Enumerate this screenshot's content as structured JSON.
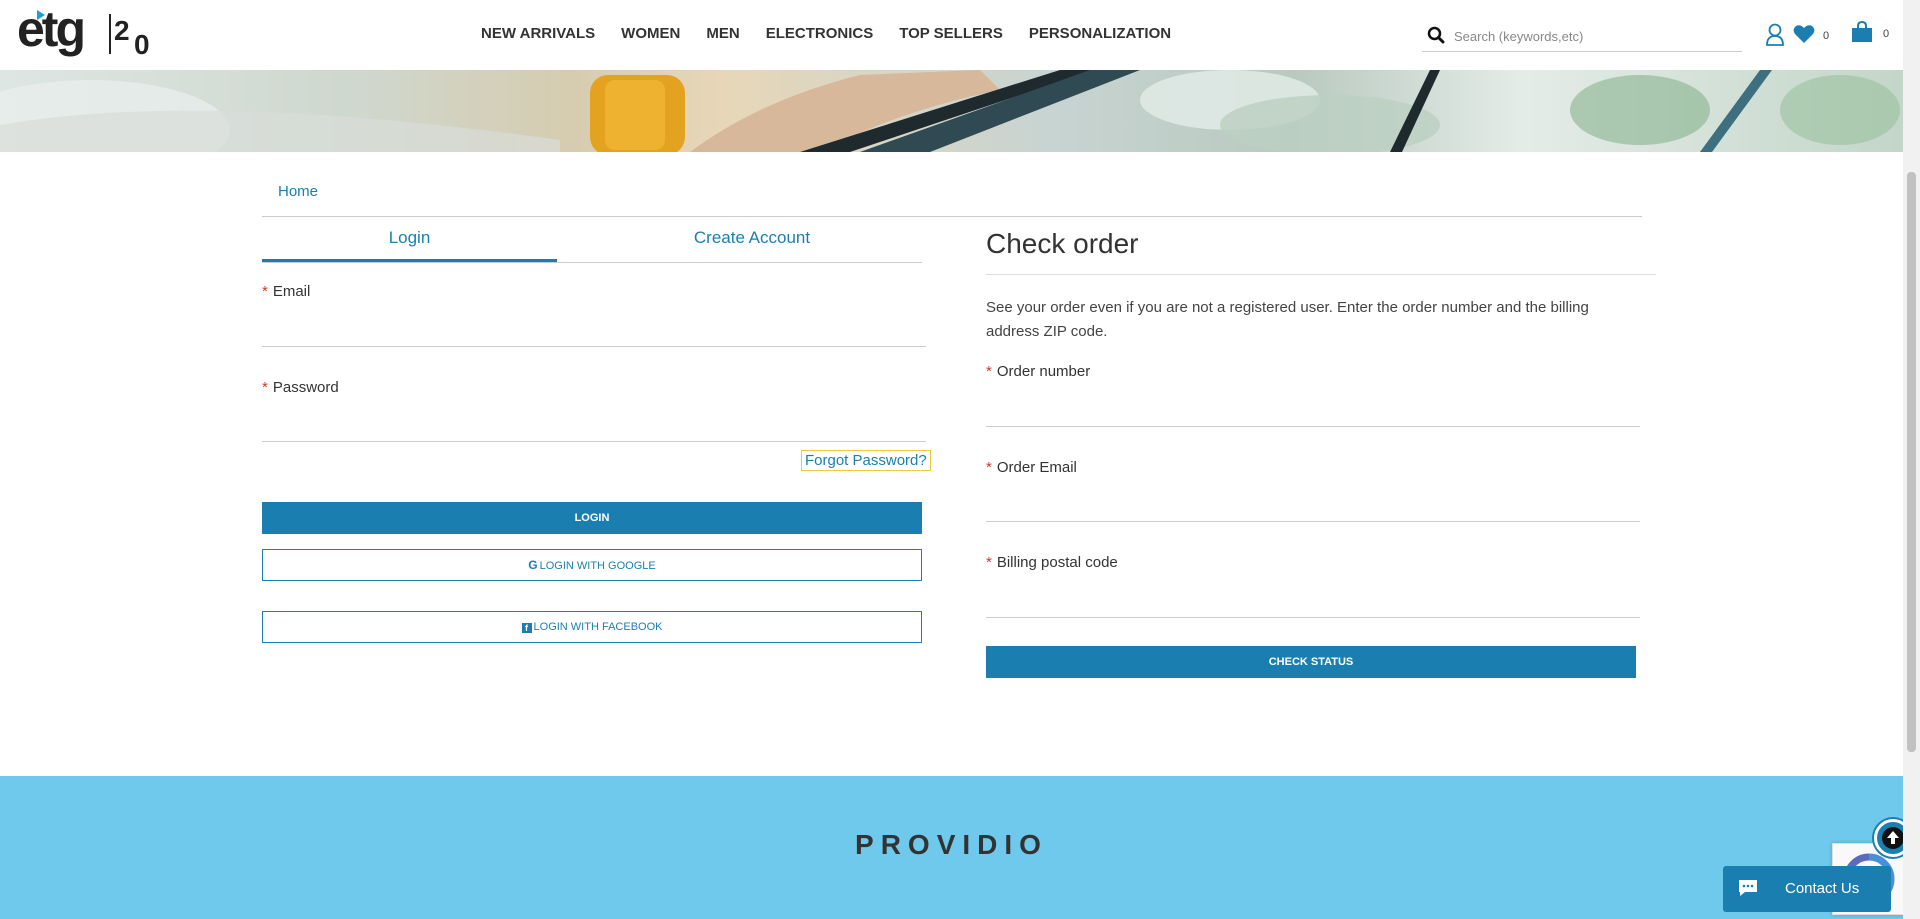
{
  "header": {
    "logo_text": "etg 20",
    "nav": [
      "NEW ARRIVALS",
      "WOMEN",
      "MEN",
      "ELECTRONICS",
      "TOP SELLERS",
      "PERSONALIZATION"
    ],
    "search_placeholder": "Search (keywords,etc)",
    "wishlist_count": "0",
    "cart_count": "0"
  },
  "breadcrumb": {
    "home": "Home"
  },
  "login": {
    "tabs": [
      "Login",
      "Create Account"
    ],
    "email_label": "Email",
    "password_label": "Password",
    "required_mark": "*",
    "forgot_label": "Forgot Password?",
    "login_button": "LOGIN",
    "google_button": "LOGIN WITH GOOGLE",
    "facebook_button": "LOGIN WITH FACEBOOK"
  },
  "check_order": {
    "title": "Check order",
    "description": "See your order even if you are not a registered user. Enter the order number and the billing address ZIP code.",
    "order_number_label": "Order number",
    "order_email_label": "Order Email",
    "postal_label": "Billing postal code",
    "check_button": "CHECK STATUS"
  },
  "footer": {
    "brand": "PROVIDIO"
  },
  "contact": {
    "label": "Contact Us"
  },
  "colors": {
    "accent": "#1a7fb0",
    "footer_bg": "#6ec9ec",
    "required": "#d9342b"
  }
}
